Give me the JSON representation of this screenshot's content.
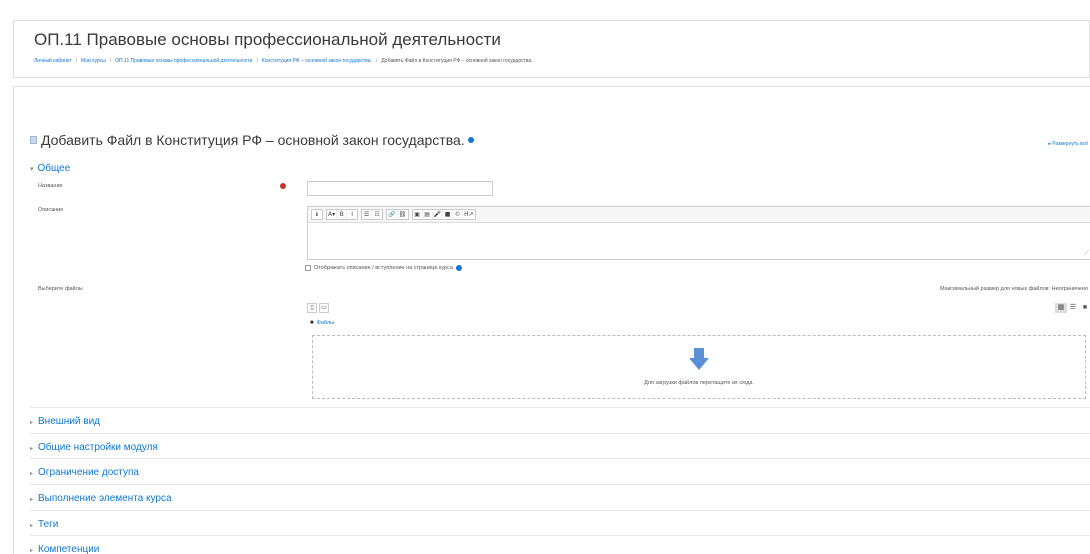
{
  "course_title": "ОП.11 Правовые основы профессиональной деятельности",
  "breadcrumb": [
    "Личный кабинет",
    "Мои курсы",
    "ОП.11 Правовые основы профессиональной деятельности",
    "Конституция РФ – основной закон государства.",
    "Добавить Файл в Конституция РФ – основной закон государства."
  ],
  "page_heading": "Добавить Файл в Конституция РФ – основной закон государства.",
  "expand_all": "Развернуть всё",
  "general_section": {
    "label": "Общее",
    "name_label": "Название",
    "name_value": "",
    "description_label": "Описание",
    "show_description": "Отображать описание / вступление на странице курса",
    "select_files_label": "Выберите файлы",
    "max_size": "Максимальный размер для новых файлов: Неограничено",
    "files_path": "Файлы",
    "drop_text": "Для загрузки файлов перетащите их сюда."
  },
  "editor_toolbar": [
    [
      "ℹ"
    ],
    [
      "A▾",
      "B",
      "I"
    ],
    [
      "☰",
      "☷"
    ],
    [
      "🔗",
      "⛓"
    ],
    [
      "▣",
      "▤",
      "🎤",
      "■",
      "©",
      "H↗"
    ]
  ],
  "sections": [
    "Внешний вид",
    "Общие настройки модуля",
    "Ограничение доступа",
    "Выполнение элемента курса",
    "Теги",
    "Компетенции"
  ],
  "colors": {
    "link": "#1177d1",
    "required": "#c0392b",
    "arrow": "#5b8fd6"
  }
}
